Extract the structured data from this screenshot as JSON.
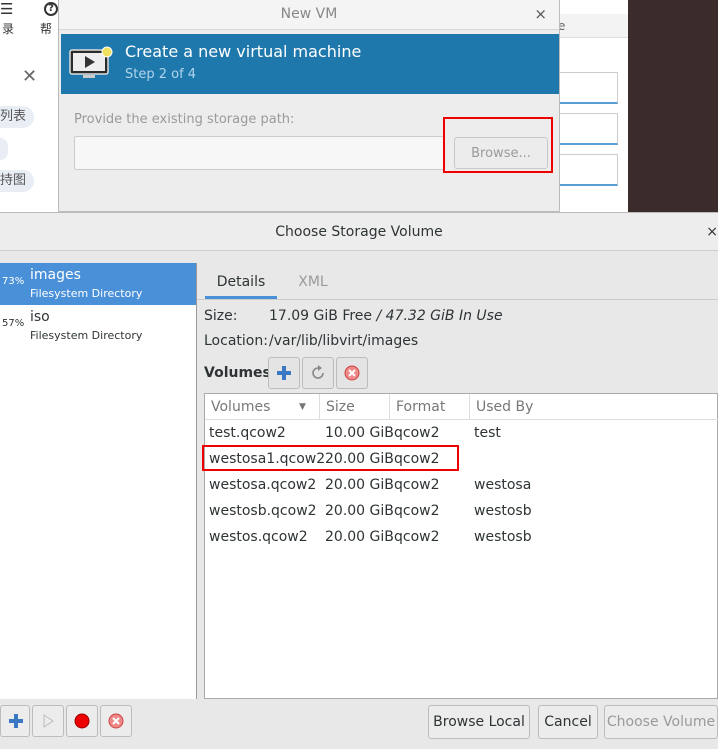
{
  "background": {
    "toolbar_left": "录",
    "toolbar_help": "帮",
    "help_icon": "?",
    "close_glyph": "✕",
    "tag1": "列表",
    "tag2": "持图",
    "right_strip": "e"
  },
  "new_vm": {
    "title": "New VM",
    "close_glyph": "×",
    "heading": "Create a new virtual machine",
    "step": "Step 2 of 4",
    "path_label": "Provide the existing storage path:",
    "path_value": "",
    "browse_label": "Browse..."
  },
  "dialog": {
    "title": "Choose Storage Volume",
    "close_glyph": "×",
    "pools": [
      {
        "pct": "73%",
        "name": "images",
        "type": "Filesystem Directory",
        "selected": true
      },
      {
        "pct": "57%",
        "name": "iso",
        "type": "Filesystem Directory",
        "selected": false
      }
    ],
    "tabs": {
      "details": "Details",
      "xml": "XML"
    },
    "size_label": "Size:",
    "size_free": "17.09 GiB Free",
    "size_sep": " / ",
    "size_inuse": "47.32 GiB In Use",
    "location_label": "Location:",
    "location_value": "/var/lib/libvirt/images",
    "volumes_label": "Volumes",
    "columns": {
      "name": "Volumes",
      "size": "Size",
      "format": "Format",
      "used_by": "Used By"
    },
    "volumes": [
      {
        "name": "test.qcow2",
        "size": "10.00 GiB",
        "format": "qcow2",
        "used_by": "test"
      },
      {
        "name": "westosa1.qcow2",
        "size": "20.00 GiB",
        "format": "qcow2",
        "used_by": ""
      },
      {
        "name": "westosa.qcow2",
        "size": "20.00 GiB",
        "format": "qcow2",
        "used_by": "westosa"
      },
      {
        "name": "westosb.qcow2",
        "size": "20.00 GiB",
        "format": "qcow2",
        "used_by": "westosb"
      },
      {
        "name": "westos.qcow2",
        "size": "20.00 GiB",
        "format": "qcow2",
        "used_by": "westosb"
      }
    ],
    "buttons": {
      "browse_local": "Browse Local",
      "cancel": "Cancel",
      "choose_volume": "Choose Volume"
    }
  },
  "colors": {
    "accent": "#4a90d9",
    "banner": "#1f78ab",
    "highlight": "#e00000"
  }
}
